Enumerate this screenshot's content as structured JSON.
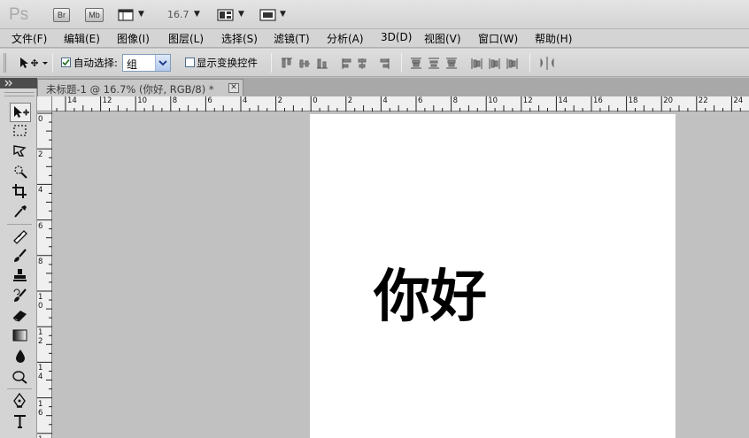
{
  "app": {
    "logo": "Ps",
    "bridge_label": "Br",
    "minibridge_label": "Mb",
    "zoom_value": "16.7"
  },
  "menu": [
    {
      "label": "文件(F)"
    },
    {
      "label": "编辑(E)"
    },
    {
      "label": "图像(I)"
    },
    {
      "label": "图层(L)"
    },
    {
      "label": "选择(S)"
    },
    {
      "label": "滤镜(T)"
    },
    {
      "label": "分析(A)"
    },
    {
      "label": "3D(D)"
    },
    {
      "label": "视图(V)"
    },
    {
      "label": "窗口(W)"
    },
    {
      "label": "帮助(H)"
    }
  ],
  "options": {
    "auto_select_label": "自动选择:",
    "auto_select_checked": true,
    "auto_select_value": "组",
    "show_transform_label": "显示变换控件",
    "show_transform_checked": false
  },
  "document": {
    "tab_title": "未标题-1 @ 16.7% (你好, RGB/8) *",
    "close_symbol": "✕",
    "canvas_text": "你好"
  },
  "rulers": {
    "top": [
      "14",
      "12",
      "10",
      "8",
      "6",
      "4",
      "2",
      "0",
      "2",
      "4",
      "6",
      "8",
      "10",
      "12",
      "14",
      "16",
      "18",
      "20",
      "22",
      "24"
    ],
    "left": [
      "0",
      "2",
      "4",
      "6",
      "8",
      "10",
      "12",
      "14",
      "16",
      "1"
    ]
  },
  "tools": [
    {
      "name": "move-tool-icon"
    },
    {
      "name": "marquee-tool-icon"
    },
    {
      "name": "lasso-tool-icon"
    },
    {
      "name": "quick-select-tool-icon"
    },
    {
      "name": "crop-tool-icon"
    },
    {
      "name": "eyedropper-tool-icon"
    },
    {
      "name": "healing-brush-tool-icon"
    },
    {
      "name": "brush-tool-icon"
    },
    {
      "name": "clone-stamp-tool-icon"
    },
    {
      "name": "history-brush-tool-icon"
    },
    {
      "name": "eraser-tool-icon"
    },
    {
      "name": "gradient-tool-icon"
    },
    {
      "name": "blur-tool-icon"
    },
    {
      "name": "dodge-tool-icon"
    },
    {
      "name": "pen-tool-icon"
    },
    {
      "name": "type-tool-icon"
    }
  ],
  "colors": {
    "ui_background": "#d4d4d4",
    "workspace": "#c1c1c1",
    "canvas": "#ffffff"
  }
}
